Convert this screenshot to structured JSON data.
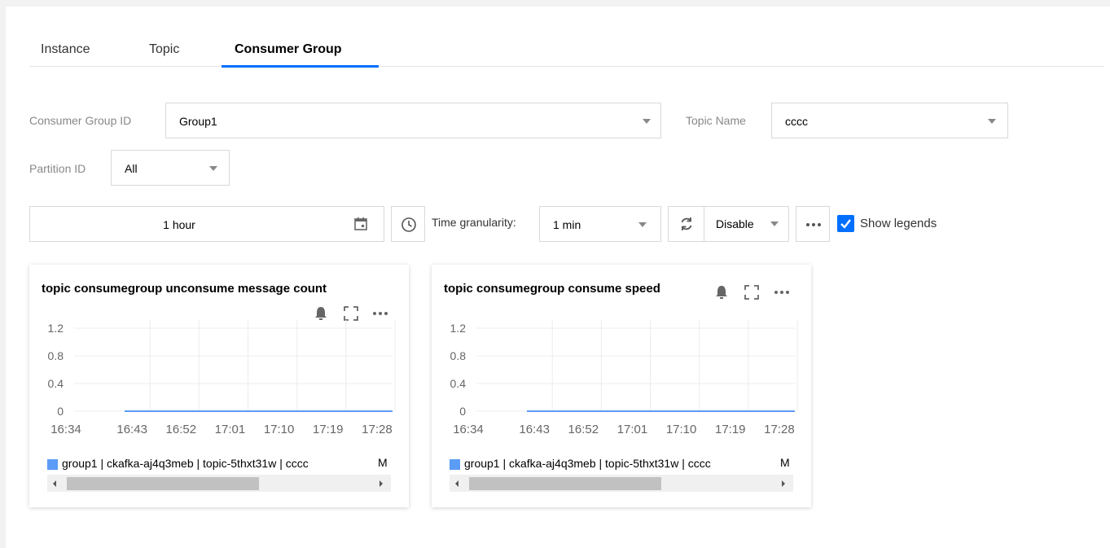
{
  "tabs": [
    {
      "label": "Instance"
    },
    {
      "label": "Topic"
    },
    {
      "label": "Consumer Group"
    }
  ],
  "active_tab": "Consumer Group",
  "filters": {
    "consumer_group_label": "Consumer Group ID",
    "consumer_group_value": "Group1",
    "topic_name_label": "Topic Name",
    "topic_name_value": "cccc",
    "partition_label": "Partition ID",
    "partition_value": "All"
  },
  "toolbar": {
    "time_range": "1 hour",
    "granularity_label": "Time granularity:",
    "granularity_value": "1 min",
    "refresh_value": "Disable",
    "show_legends_label": "Show legends",
    "show_legends_checked": true
  },
  "colors": {
    "accent": "#006eff",
    "series": "#5b9cf6"
  },
  "charts": [
    {
      "title": "topic consumegroup unconsume message count",
      "legend": "group1 | ckafka-aj4q3meb | topic-5thxt31w | cccc",
      "legend_overflow": "M"
    },
    {
      "title": "topic consumegroup consume speed",
      "legend": "group1 | ckafka-aj4q3meb | topic-5thxt31w | cccc",
      "legend_overflow": "M"
    }
  ],
  "chart_data": [
    {
      "type": "line",
      "title": "topic consumegroup unconsume message count",
      "x": [
        "16:34",
        "16:43",
        "16:52",
        "17:01",
        "17:10",
        "17:19",
        "17:28"
      ],
      "yticks": [
        "1.2",
        "0.8",
        "0.4",
        "0"
      ],
      "ylim": [
        0,
        1.2
      ],
      "grid": true,
      "legend_position": "bottom",
      "series": [
        {
          "name": "group1 | ckafka-aj4q3meb | topic-5thxt31w | cccc",
          "values": [
            0,
            0,
            0,
            0,
            0,
            0,
            0
          ]
        }
      ]
    },
    {
      "type": "line",
      "title": "topic consumegroup consume speed",
      "x": [
        "16:34",
        "16:43",
        "16:52",
        "17:01",
        "17:10",
        "17:19",
        "17:28"
      ],
      "yticks": [
        "1.2",
        "0.8",
        "0.4",
        "0"
      ],
      "ylim": [
        0,
        1.2
      ],
      "grid": true,
      "legend_position": "bottom",
      "series": [
        {
          "name": "group1 | ckafka-aj4q3meb | topic-5thxt31w | cccc",
          "values": [
            0,
            0,
            0,
            0,
            0,
            0,
            0
          ]
        }
      ]
    }
  ]
}
